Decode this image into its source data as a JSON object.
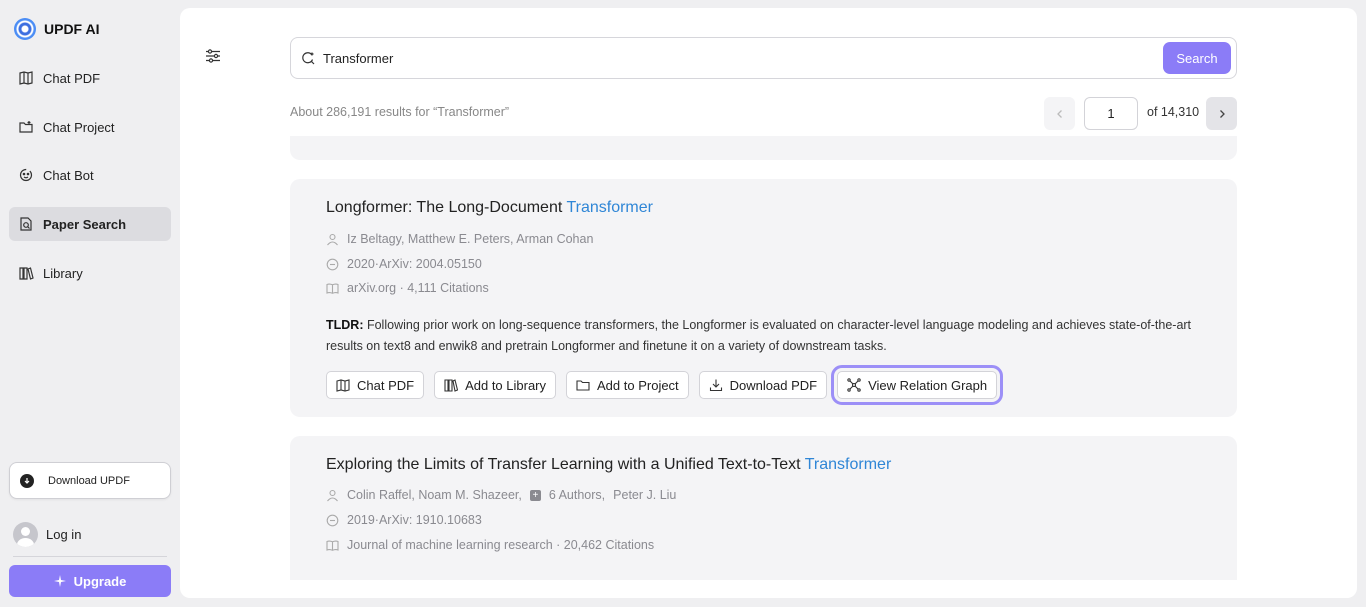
{
  "sidebar": {
    "brand": "UPDF AI",
    "items": [
      {
        "label": "Chat PDF",
        "icon": "chat-pdf-icon"
      },
      {
        "label": "Chat Project",
        "icon": "chat-project-icon"
      },
      {
        "label": "Chat Bot",
        "icon": "chat-bot-icon"
      },
      {
        "label": "Paper Search",
        "icon": "paper-search-icon",
        "active": true
      },
      {
        "label": "Library",
        "icon": "library-icon"
      }
    ],
    "download_label": "Download UPDF",
    "login_label": "Log in",
    "upgrade_label": "Upgrade"
  },
  "search": {
    "query": "Transformer",
    "button_label": "Search"
  },
  "results": {
    "summary": "About 286,191 results for “Transformer”",
    "current_page": "1",
    "total_pages": "of 14,310"
  },
  "papers": [
    {
      "title_prefix": "Longformer: The Long-Document ",
      "title_highlight": "Transformer",
      "authors": "Iz Beltagy,  Matthew E. Peters,  Arman Cohan",
      "year_source": "2020·ArXiv: 2004.05150",
      "venue_citations": "arXiv.org · 4,111 Citations",
      "tldr_label": "TLDR:",
      "tldr_text": " Following prior work on long-sequence transformers, the Longformer is evaluated on character-level language modeling and achieves state-of-the-art results on text8 and enwik8 and pretrain Longformer and finetune it on a variety of downstream tasks.",
      "actions": [
        "Chat PDF",
        "Add to Library",
        "Add to Project",
        "Download PDF",
        "View Relation Graph"
      ]
    },
    {
      "title_prefix": "Exploring the Limits of Transfer Learning with a Unified Text-to-Text ",
      "title_highlight": "Transformer",
      "authors_a": "Colin Raffel,  Noam M. Shazeer,",
      "more_authors": "6 Authors,",
      "authors_b": "Peter J. Liu",
      "year_source": "2019·ArXiv: 1910.10683",
      "venue_citations": "Journal of machine learning research · 20,462 Citations"
    }
  ],
  "colors": {
    "accent": "#8b7cf7",
    "highlight_link": "#2f86d6",
    "focus_outline": "#9c8ff7"
  }
}
